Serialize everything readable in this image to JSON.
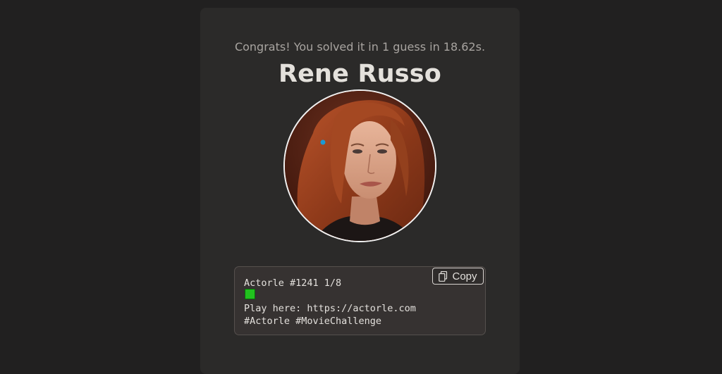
{
  "result": {
    "congrats_text": "Congrats! You solved it in 1 guess in 18.62s.",
    "actor_name": "Rene Russo"
  },
  "share": {
    "title_line": "Actorle #1241 1/8",
    "guess_results": [
      "correct"
    ],
    "play_line": "Play here: https://actorle.com",
    "tags_line": "#Actorle #MovieChallenge",
    "copy_label": "Copy",
    "copy_icon": "copy-icon"
  },
  "colors": {
    "page_background": "#212020",
    "card_background": "#2b2a29",
    "correct_square": "#21c21e"
  }
}
